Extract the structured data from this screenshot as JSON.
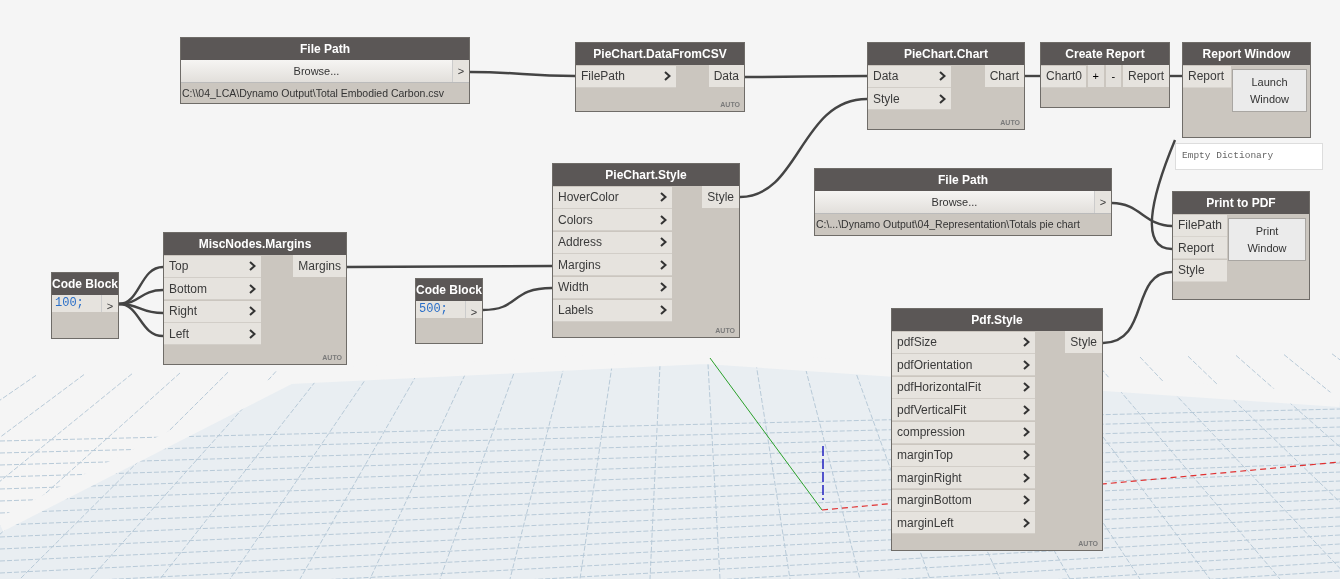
{
  "nodes": [
    {
      "kind": "browse",
      "title": "File Path",
      "button": "Browse...",
      "port": ">",
      "path": "C:\\\\04_LCA\\Dynamo Output\\Total Embodied Carbon.csv"
    },
    {
      "kind": "function",
      "title": "PieChart.DataFromCSV",
      "inputs": [
        "FilePath"
      ],
      "outputs": [
        "Data"
      ],
      "lacing": "AUTO"
    },
    {
      "kind": "function",
      "title": "PieChart.Chart",
      "inputs": [
        "Data",
        "Style"
      ],
      "outputs": [
        "Chart"
      ],
      "lacing": "AUTO"
    },
    {
      "kind": "report",
      "title": "Create Report",
      "input": "Chart0",
      "add": "+",
      "remove": "-",
      "output": "Report"
    },
    {
      "kind": "window",
      "title": "Report Window",
      "inputs": [
        "Report"
      ],
      "button": "Launch Window",
      "preview": "Empty Dictionary"
    },
    {
      "kind": "function",
      "title": "PieChart.Style",
      "inputs": [
        "HoverColor",
        "Colors",
        "Address",
        "Margins",
        "Width",
        "Labels"
      ],
      "outputs": [
        "Style"
      ],
      "lacing": "AUTO"
    },
    {
      "kind": "browse",
      "title": "File Path",
      "button": "Browse...",
      "port": ">",
      "path": "C:\\...\\Dynamo Output\\04_Representation\\Totals pie chart"
    },
    {
      "kind": "window",
      "title": "Print to PDF",
      "inputs": [
        "FilePath",
        "Report",
        "Style"
      ],
      "button": "Print Window"
    },
    {
      "kind": "function",
      "title": "MiscNodes.Margins",
      "inputs": [
        "Top",
        "Bottom",
        "Right",
        "Left"
      ],
      "outputs": [
        "Margins"
      ],
      "lacing": "AUTO"
    },
    {
      "kind": "code",
      "title": "Code Block",
      "code": "100;",
      "port": ">"
    },
    {
      "kind": "code",
      "title": "Code Block",
      "code": "500;",
      "port": ">"
    },
    {
      "kind": "function",
      "title": "Pdf.Style",
      "inputs": [
        "pdfSize",
        "pdfOrientation",
        "pdfHorizontalFit",
        "pdfVerticalFit",
        "compression",
        "marginTop",
        "marginRight",
        "marginBottom",
        "marginLeft"
      ],
      "outputs": [
        "Style"
      ],
      "lacing": "AUTO"
    }
  ]
}
